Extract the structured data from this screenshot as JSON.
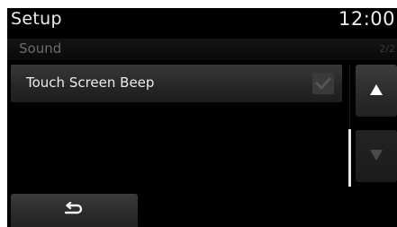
{
  "header": {
    "title": "Setup",
    "clock": "12:00"
  },
  "subheader": {
    "label": "Sound",
    "page_indicator": "2/2"
  },
  "list": {
    "items": [
      {
        "label": "Touch Screen Beep",
        "checked": true
      }
    ]
  },
  "navigation": {
    "scroll_up_icon": "triangle-up-icon",
    "scroll_down_icon": "triangle-down-icon",
    "back_icon": "back-arrow-icon"
  },
  "colors": {
    "background": "#000000",
    "text_primary": "#ececec",
    "text_muted": "#6c6c6c",
    "button": "#2e2e2e"
  }
}
